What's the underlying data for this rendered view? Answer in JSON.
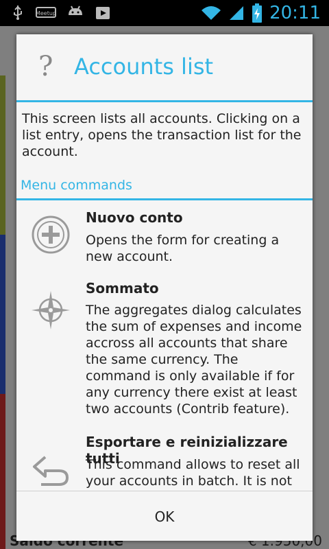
{
  "statusbar": {
    "time": "20:11",
    "left_icons": [
      "usb-icon",
      "meetup-icon",
      "android-icon",
      "play-store-icon"
    ],
    "right_icons": [
      "wifi-icon",
      "signal-icon",
      "battery-charging-icon"
    ]
  },
  "background": {
    "footer_label": "Saldo corrente",
    "footer_value": "€ 1.950,00",
    "stripe_colors": [
      "#7a8a2a",
      "#1b3a8c",
      "#8c1b1b"
    ],
    "accent": "#33b5e5"
  },
  "dialog": {
    "help_icon": "?",
    "title": "Accounts list",
    "intro": "This screen lists all accounts. Clicking on a list entry, opens the transaction list for the account.",
    "section_label": "Menu commands",
    "commands": [
      {
        "icon": "add-circle-icon",
        "title": "Nuovo conto",
        "description": "Opens the form for creating a new account."
      },
      {
        "icon": "aggregate-compass-icon",
        "title": "Sommato",
        "description": "The aggregates dialog calculates the sum of expenses and income accross all accounts that share the same currency. The command is only available if for any currency there exist at least two accounts (Contrib feature)."
      },
      {
        "icon": "reset-arrow-icon",
        "title": "Esportare e reinizializzare tutti",
        "description": "This command allows to reset all your accounts in batch. It is not"
      }
    ],
    "ok_label": "OK"
  }
}
